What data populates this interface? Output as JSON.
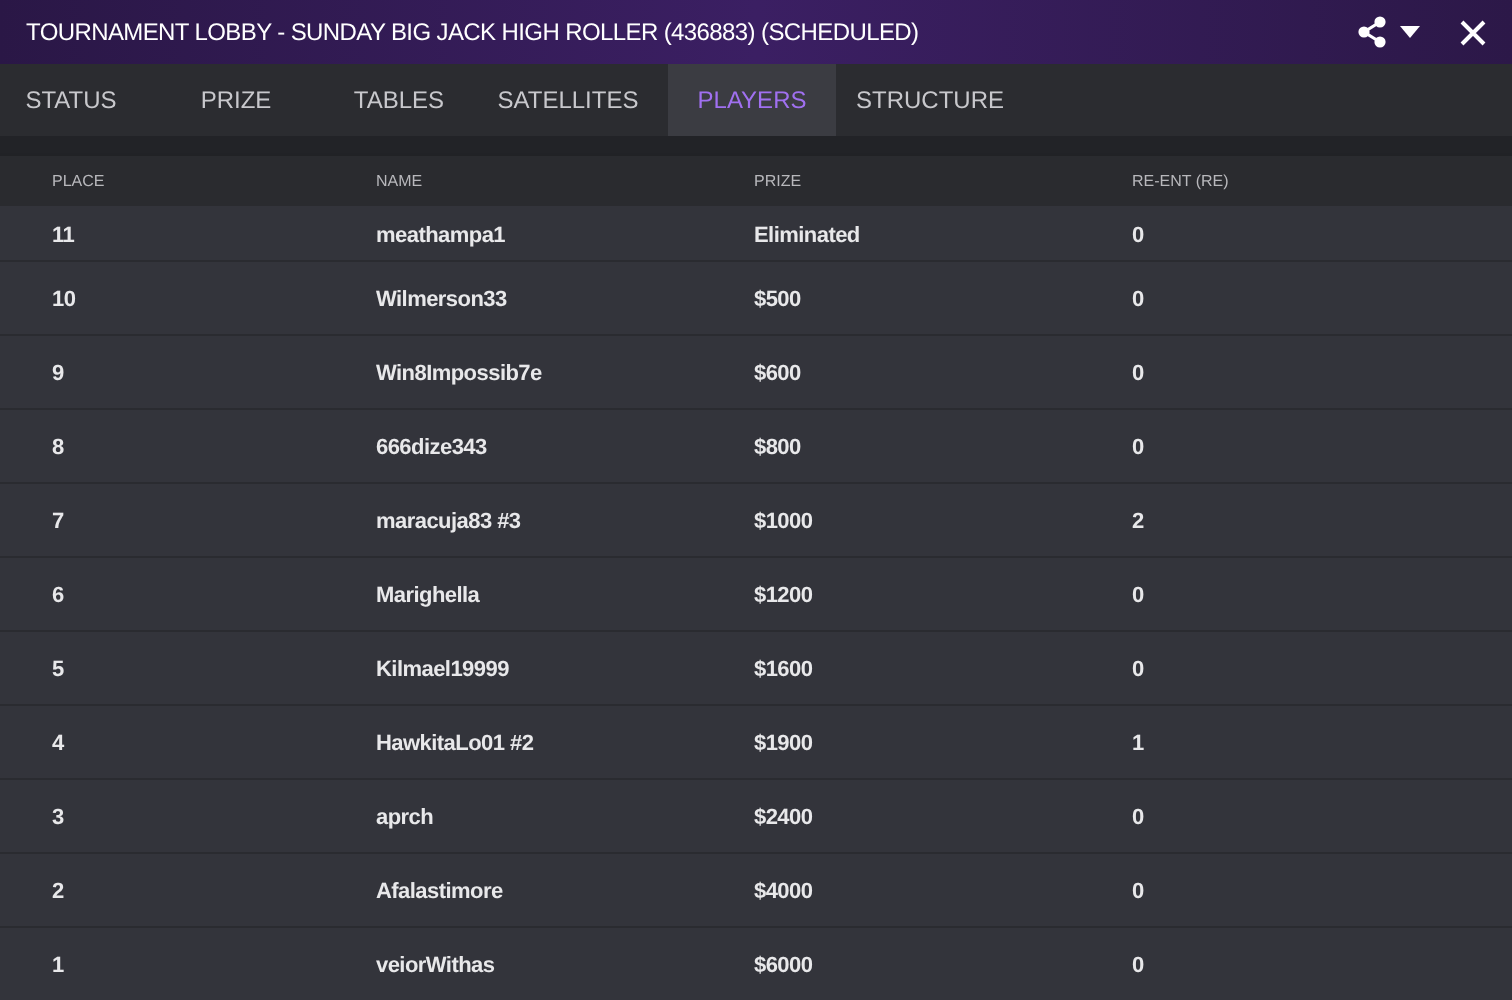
{
  "window": {
    "title": "TOURNAMENT LOBBY - SUNDAY BIG JACK HIGH ROLLER (436883) (SCHEDULED)"
  },
  "tabs": [
    {
      "label": "STATUS",
      "selected": false
    },
    {
      "label": "PRIZE",
      "selected": false
    },
    {
      "label": "TABLES",
      "selected": false
    },
    {
      "label": "SATELLITES",
      "selected": false
    },
    {
      "label": "PLAYERS",
      "selected": true
    },
    {
      "label": "STRUCTURE",
      "selected": false
    }
  ],
  "table": {
    "columns": [
      "PLACE",
      "NAME",
      "PRIZE",
      "RE-ENT (RE)"
    ],
    "rows": [
      [
        "11",
        "meathampa1",
        "Eliminated",
        "0"
      ],
      [
        "10",
        "Wilmerson33",
        "$500",
        "0"
      ],
      [
        "9",
        "Win8Impossib7e",
        "$600",
        "0"
      ],
      [
        "8",
        "666dize343",
        "$800",
        "0"
      ],
      [
        "7",
        "maracuja83 #3",
        "$1000",
        "2"
      ],
      [
        "6",
        "Marighella",
        "$1200",
        "0"
      ],
      [
        "5",
        "Kilmael19999",
        "$1600",
        "0"
      ],
      [
        "4",
        "HawkitaLo01 #2",
        "$1900",
        "1"
      ],
      [
        "3",
        "aprch",
        "$2400",
        "0"
      ],
      [
        "2",
        "Afalastimore",
        "$4000",
        "0"
      ],
      [
        "1",
        "veiorWithas",
        "$6000",
        "0"
      ]
    ]
  }
}
